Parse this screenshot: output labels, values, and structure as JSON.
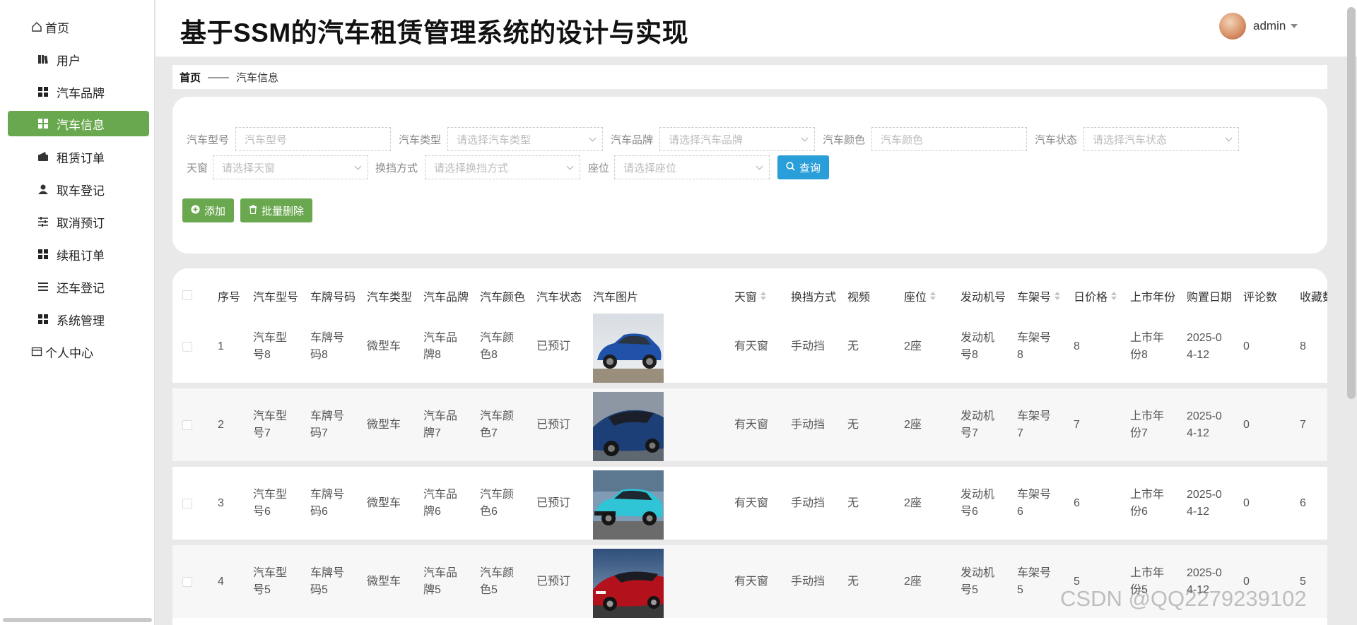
{
  "app": {
    "title": "基于SSM的汽车租赁管理系统的设计与实现"
  },
  "user": {
    "name": "admin",
    "avatar_icon": "anime-avatar"
  },
  "menu": {
    "home": "首页",
    "items": [
      {
        "label": "用户",
        "icon": "book-icon"
      },
      {
        "label": "汽车品牌",
        "icon": "grid-icon"
      },
      {
        "label": "汽车信息",
        "icon": "grid-icon",
        "active": true
      },
      {
        "label": "租赁订单",
        "icon": "wallet-icon"
      },
      {
        "label": "取车登记",
        "icon": "person-icon"
      },
      {
        "label": "取消预订",
        "icon": "sliders-icon"
      },
      {
        "label": "续租订单",
        "icon": "grid-icon"
      },
      {
        "label": "还车登记",
        "icon": "list-icon"
      },
      {
        "label": "系统管理",
        "icon": "grid-icon"
      }
    ],
    "personal": "个人中心"
  },
  "breadcrumb": {
    "home": "首页",
    "separator": "——",
    "current": "汽车信息"
  },
  "search": {
    "fields": [
      {
        "label": "汽车型号",
        "placeholder": "汽车型号"
      },
      {
        "label": "汽车类型",
        "placeholder": "请选择汽车类型"
      },
      {
        "label": "汽车品牌",
        "placeholder": "请选择汽车品牌"
      },
      {
        "label": "汽车颜色",
        "placeholder": "汽车颜色"
      },
      {
        "label": "汽车状态",
        "placeholder": "请选择汽车状态"
      },
      {
        "label": "天窗",
        "placeholder": "请选择天窗"
      },
      {
        "label": "换挡方式",
        "placeholder": "请选择换挡方式"
      },
      {
        "label": "座位",
        "placeholder": "请选择座位"
      }
    ],
    "query_button": "查询",
    "add_button": "添加",
    "batch_delete_button": "批量删除"
  },
  "table": {
    "headers": [
      "序号",
      "汽车型号",
      "车牌号码",
      "汽车类型",
      "汽车品牌",
      "汽车颜色",
      "汽车状态",
      "汽车图片",
      "天窗",
      "换挡方式",
      "视频",
      "座位",
      "发动机号",
      "车架号",
      "日价格",
      "上市年份",
      "购置日期",
      "评论数",
      "收藏数"
    ],
    "rows": [
      {
        "index": "1",
        "model": [
          "汽车型",
          "号8"
        ],
        "plate": [
          "车牌号",
          "码8"
        ],
        "type": "微型车",
        "brand": [
          "汽车品",
          "牌8"
        ],
        "color": [
          "汽车颜",
          "色8"
        ],
        "status": "已预订",
        "image": "blue-suv",
        "sunroof": "有天窗",
        "gear": "手动挡",
        "video": "无",
        "seats": "2座",
        "engine": [
          "发动机",
          "号8"
        ],
        "frame": [
          "车架号",
          "8"
        ],
        "price": "8",
        "year": [
          "上市年",
          "份8"
        ],
        "date": [
          "2025-0",
          "4-12"
        ],
        "comments": "0",
        "favorites": "8"
      },
      {
        "index": "2",
        "model": [
          "汽车型",
          "号7"
        ],
        "plate": [
          "车牌号",
          "码7"
        ],
        "type": "微型车",
        "brand": [
          "汽车品",
          "牌7"
        ],
        "color": [
          "汽车颜",
          "色7"
        ],
        "status": "已预订",
        "image": "blue-sedan",
        "sunroof": "有天窗",
        "gear": "手动挡",
        "video": "无",
        "seats": "2座",
        "engine": [
          "发动机",
          "号7"
        ],
        "frame": [
          "车架号",
          "7"
        ],
        "price": "7",
        "year": [
          "上市年",
          "份7"
        ],
        "date": [
          "2025-0",
          "4-12"
        ],
        "comments": "0",
        "favorites": "7"
      },
      {
        "index": "3",
        "model": [
          "汽车型",
          "号6"
        ],
        "plate": [
          "车牌号",
          "码6"
        ],
        "type": "微型车",
        "brand": [
          "汽车品",
          "牌6"
        ],
        "color": [
          "汽车颜",
          "色6"
        ],
        "status": "已预订",
        "image": "cyan-suv",
        "sunroof": "有天窗",
        "gear": "手动挡",
        "video": "无",
        "seats": "2座",
        "engine": [
          "发动机",
          "号6"
        ],
        "frame": [
          "车架号",
          "6"
        ],
        "price": "6",
        "year": [
          "上市年",
          "份6"
        ],
        "date": [
          "2025-0",
          "4-12"
        ],
        "comments": "0",
        "favorites": "6"
      },
      {
        "index": "4",
        "model": [
          "汽车型",
          "号5"
        ],
        "plate": [
          "车牌号",
          "码5"
        ],
        "type": "微型车",
        "brand": [
          "汽车品",
          "牌5"
        ],
        "color": [
          "汽车颜",
          "色5"
        ],
        "status": "已预订",
        "image": "red-sedan",
        "sunroof": "有天窗",
        "gear": "手动挡",
        "video": "无",
        "seats": "2座",
        "engine": [
          "发动机",
          "号5"
        ],
        "frame": [
          "车架号",
          "5"
        ],
        "price": "5",
        "year": [
          "上市年",
          "份5"
        ],
        "date": [
          "2025-0",
          "4-12"
        ],
        "comments": "0",
        "favorites": "5"
      }
    ]
  },
  "watermark": "CSDN @QQ2279239102",
  "colors": {
    "accent": "#6aa84f",
    "query": "#2a9ed8"
  }
}
